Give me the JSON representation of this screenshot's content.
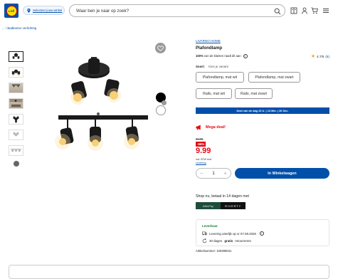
{
  "header": {
    "logo_text": "Lidl",
    "store_label": "Selecteer jouw winkel",
    "search_placeholder": "Waar ben je naar op zoek?"
  },
  "breadcrumb": {
    "prefix": "...",
    "sep": "/",
    "item": "Badkamer verlichting"
  },
  "product": {
    "brand": "LIVARNO HOME",
    "title": "Plafondlamp",
    "recommend_pct": "100%",
    "recommend_text": "van de klanten raadt dit aan",
    "rating": "4.7/5",
    "rating_count": "(6)",
    "sort_label": "Soort:",
    "sort_hint": "Kies je variant",
    "variants": [
      "Plafondlamp, mat wit",
      "Plafondlamp, mat zwart",
      "Rails, mat wit",
      "Rails, mat zwart"
    ],
    "deal_banner": "Deal van de dag 23 U. | 13 Min. | 30 Sec.",
    "mega_deal": "Mega deal!",
    "old_price": "29.99",
    "discount": "-66%",
    "price": "9.99",
    "btw": "incl. BTW excl.",
    "delivery_link": "Levering",
    "quantity": "1",
    "cart_label": "In Winkelwagen",
    "shop_now": "Shop nu, betaal in 14 dagen met",
    "pay_a": "AfterPay",
    "pay_b": "RIVERTY",
    "availability": "Leverbaar",
    "delivery_by": "Levering uiterlijk op vr 07.08.2026",
    "returns_pre": "30 dagen",
    "returns_bold": "gratis",
    "returns_post": "retourneren",
    "article_number": "Artikelnummer: 100395031"
  },
  "colors": {
    "brand_blue": "#0050aa",
    "sale_red": "#e60a14",
    "yellow": "#ffe500",
    "available_green": "#1e7b34"
  }
}
